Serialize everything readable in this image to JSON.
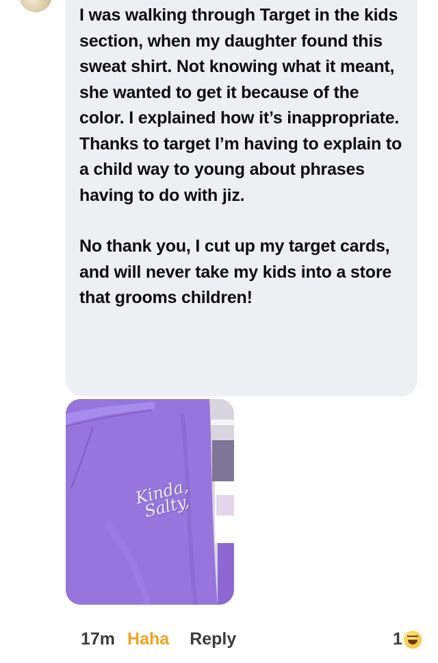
{
  "comment": {
    "paragraphs": [
      "I was walking through Target in the kids section, when my daughter found this sweat shirt. Not knowing what it meant, she wanted to get it because of the color. I explained how it’s inappropriate. Thanks to target I’m having to explain to a child way to young about phrases having to do with jiz.",
      "No thank you, I cut up my target cards, and will never take my kids into a store that grooms children!"
    ]
  },
  "photo": {
    "shirt_text_line1": "Kinda,",
    "shirt_text_line2": "Salty,",
    "shirt_color": "#9a7be0"
  },
  "footer": {
    "time": "17m",
    "haha_label": "Haha",
    "reply_label": "Reply",
    "reaction_count": "1",
    "reaction_icon": "haha-emoji-icon"
  },
  "colors": {
    "bubble": "#edeff3",
    "haha": "#f0a321",
    "text": "#0d0d0d",
    "meta": "#3a3b3c"
  }
}
